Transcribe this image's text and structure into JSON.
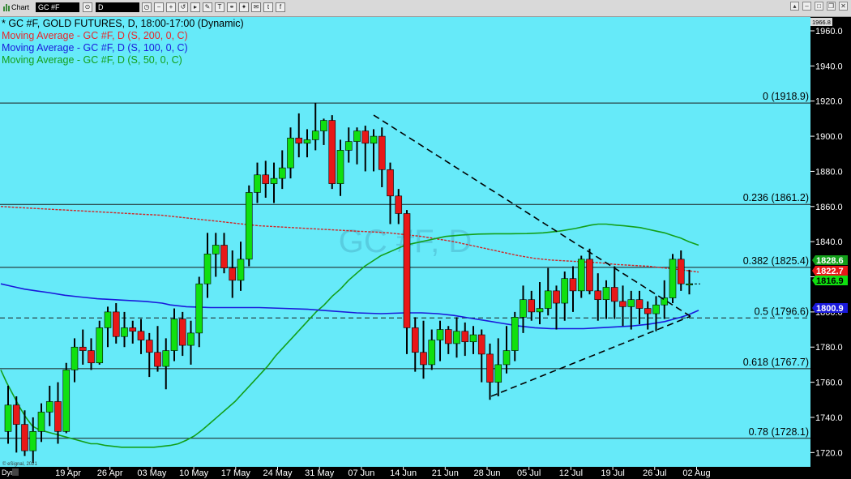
{
  "window": {
    "app_label": "Chart",
    "symbol": "GC #F",
    "interval": "D"
  },
  "legend": [
    {
      "text": "* GC #F, GOLD FUTURES, D, 18:00-17:00 (Dynamic)",
      "color": "#000000"
    },
    {
      "text": "Moving Average - GC #F, D (S, 200, 0, C)",
      "color": "#e8262a"
    },
    {
      "text": "Moving Average - GC #F, D (S, 100, 0, C)",
      "color": "#1a1adb"
    },
    {
      "text": "Moving Average - GC #F, D (S, 50, 0, C)",
      "color": "#13a01a"
    }
  ],
  "watermark": "GC #F, D",
  "footer": {
    "copyright": "© eSignal, 2021",
    "dyn_label": "Dyn"
  },
  "colors": {
    "background": "#66eaf9",
    "up": "#10e010",
    "down": "#e81818",
    "ma200": "#d22525",
    "ma100": "#1a1adb",
    "ma50": "#13a01a"
  },
  "chart_data": {
    "type": "candlestick",
    "instrument": "GC #F, GOLD FUTURES",
    "ylim": [
      1712,
      1966.8
    ],
    "y_ticks": [
      "1720.0",
      "1740.0",
      "1760.0",
      "1780.0",
      "1800.0",
      "1820.0",
      "1840.0",
      "1860.0",
      "1880.0",
      "1900.0",
      "1920.0",
      "1940.0",
      "1960.0"
    ],
    "top_price_label": "1966.8",
    "x_tick_labels": [
      "19 Apr",
      "26 Apr",
      "03 May",
      "10 May",
      "17 May",
      "24 May",
      "31 May",
      "07 Jun",
      "14 Jun",
      "21 Jun",
      "28 Jun",
      "05 Jul",
      "12 Jul",
      "19 Jul",
      "26 Jul",
      "02 Aug"
    ],
    "fibonacci": [
      {
        "label": "0 (1918.9)",
        "value": 1918.9
      },
      {
        "label": "0.236 (1861.2)",
        "value": 1861.2
      },
      {
        "label": "0.382 (1825.4)",
        "value": 1825.4
      },
      {
        "label": "0.5 (1796.6)",
        "value": 1796.6
      },
      {
        "label": "0.618 (1767.7)",
        "value": 1767.7
      },
      {
        "label": "0.78 (1728.1)",
        "value": 1728.1
      }
    ],
    "price_tags": [
      {
        "label": "1828.6",
        "value": 1828.6,
        "color": "#13a01a"
      },
      {
        "label": "1822.7",
        "value": 1822.7,
        "color": "#e81818"
      },
      {
        "label": "1816.9",
        "value": 1816.9,
        "color": "#10e010"
      },
      {
        "label": "1800.9",
        "value": 1800.9,
        "color": "#1a1adb"
      }
    ],
    "candles": [
      [
        1732,
        1758,
        1725,
        1747
      ],
      [
        1747,
        1752,
        1720,
        1736
      ],
      [
        1736,
        1744,
        1718,
        1721
      ],
      [
        1721,
        1740,
        1714,
        1732
      ],
      [
        1732,
        1748,
        1726,
        1743
      ],
      [
        1743,
        1758,
        1735,
        1749
      ],
      [
        1749,
        1760,
        1725,
        1732
      ],
      [
        1732,
        1771,
        1731,
        1767
      ],
      [
        1767,
        1785,
        1760,
        1780
      ],
      [
        1780,
        1790,
        1770,
        1778
      ],
      [
        1778,
        1785,
        1767,
        1771
      ],
      [
        1771,
        1795,
        1770,
        1791
      ],
      [
        1791,
        1803,
        1780,
        1800
      ],
      [
        1800,
        1805,
        1782,
        1786
      ],
      [
        1786,
        1800,
        1780,
        1791
      ],
      [
        1791,
        1795,
        1782,
        1789
      ],
      [
        1789,
        1796,
        1776,
        1784
      ],
      [
        1784,
        1788,
        1763,
        1777
      ],
      [
        1777,
        1792,
        1766,
        1769
      ],
      [
        1769,
        1785,
        1756,
        1778
      ],
      [
        1778,
        1802,
        1772,
        1796
      ],
      [
        1796,
        1800,
        1775,
        1781
      ],
      [
        1781,
        1795,
        1770,
        1788
      ],
      [
        1788,
        1820,
        1780,
        1816
      ],
      [
        1816,
        1845,
        1808,
        1833
      ],
      [
        1833,
        1845,
        1820,
        1838
      ],
      [
        1838,
        1845,
        1822,
        1825
      ],
      [
        1825,
        1835,
        1808,
        1818
      ],
      [
        1818,
        1840,
        1812,
        1830
      ],
      [
        1830,
        1872,
        1826,
        1868
      ],
      [
        1868,
        1885,
        1862,
        1878
      ],
      [
        1878,
        1886,
        1865,
        1873
      ],
      [
        1873,
        1885,
        1862,
        1876
      ],
      [
        1876,
        1892,
        1870,
        1882
      ],
      [
        1882,
        1905,
        1876,
        1899
      ],
      [
        1899,
        1913,
        1888,
        1896
      ],
      [
        1896,
        1904,
        1888,
        1898
      ],
      [
        1898,
        1919,
        1892,
        1903
      ],
      [
        1903,
        1910,
        1895,
        1909
      ],
      [
        1909,
        1912,
        1870,
        1873
      ],
      [
        1873,
        1898,
        1866,
        1892
      ],
      [
        1892,
        1905,
        1885,
        1897
      ],
      [
        1897,
        1905,
        1884,
        1903
      ],
      [
        1903,
        1906,
        1880,
        1896
      ],
      [
        1896,
        1904,
        1880,
        1900
      ],
      [
        1900,
        1905,
        1871,
        1881
      ],
      [
        1881,
        1885,
        1850,
        1866
      ],
      [
        1866,
        1870,
        1850,
        1856
      ],
      [
        1856,
        1858,
        1776,
        1791
      ],
      [
        1791,
        1797,
        1766,
        1777
      ],
      [
        1777,
        1795,
        1762,
        1770
      ],
      [
        1770,
        1790,
        1767,
        1784
      ],
      [
        1784,
        1795,
        1772,
        1790
      ],
      [
        1790,
        1792,
        1776,
        1782
      ],
      [
        1782,
        1797,
        1774,
        1789
      ],
      [
        1789,
        1794,
        1775,
        1783
      ],
      [
        1783,
        1792,
        1776,
        1787
      ],
      [
        1787,
        1790,
        1760,
        1776
      ],
      [
        1776,
        1782,
        1750,
        1760
      ],
      [
        1760,
        1785,
        1752,
        1770
      ],
      [
        1770,
        1792,
        1765,
        1778
      ],
      [
        1778,
        1800,
        1772,
        1797
      ],
      [
        1797,
        1815,
        1788,
        1807
      ],
      [
        1807,
        1812,
        1795,
        1800
      ],
      [
        1800,
        1817,
        1793,
        1802
      ],
      [
        1802,
        1825,
        1798,
        1812
      ],
      [
        1812,
        1815,
        1790,
        1805
      ],
      [
        1805,
        1823,
        1795,
        1819
      ],
      [
        1819,
        1826,
        1800,
        1812
      ],
      [
        1812,
        1832,
        1808,
        1830
      ],
      [
        1830,
        1836,
        1810,
        1812
      ],
      [
        1812,
        1822,
        1795,
        1807
      ],
      [
        1807,
        1818,
        1796,
        1814
      ],
      [
        1814,
        1826,
        1796,
        1806
      ],
      [
        1806,
        1815,
        1792,
        1803
      ],
      [
        1803,
        1812,
        1790,
        1807
      ],
      [
        1807,
        1812,
        1793,
        1802
      ],
      [
        1802,
        1806,
        1790,
        1799
      ],
      [
        1799,
        1809,
        1789,
        1804
      ],
      [
        1804,
        1818,
        1796,
        1808
      ],
      [
        1808,
        1833,
        1805,
        1830
      ],
      [
        1830,
        1835,
        1812,
        1816
      ],
      [
        1816,
        1824,
        1810,
        1816
      ]
    ],
    "ma50": [
      [
        1,
        1767
      ],
      [
        8,
        1760
      ],
      [
        16,
        1753
      ],
      [
        24,
        1746
      ],
      [
        32,
        1740
      ],
      [
        40,
        1735
      ],
      [
        48,
        1733
      ],
      [
        56,
        1732
      ],
      [
        64,
        1731
      ],
      [
        72,
        1730
      ],
      [
        80,
        1729
      ],
      [
        88,
        1728
      ],
      [
        96,
        1727
      ],
      [
        104,
        1726
      ],
      [
        112,
        1725
      ],
      [
        120,
        1725
      ],
      [
        130,
        1724
      ],
      [
        140,
        1723.5
      ],
      [
        150,
        1723
      ],
      [
        160,
        1723
      ],
      [
        170,
        1723
      ],
      [
        180,
        1723
      ],
      [
        190,
        1723
      ],
      [
        200,
        1723.5
      ],
      [
        210,
        1724
      ],
      [
        220,
        1725
      ],
      [
        230,
        1727
      ],
      [
        240,
        1729.5
      ],
      [
        250,
        1733
      ],
      [
        260,
        1737
      ],
      [
        270,
        1741
      ],
      [
        280,
        1745
      ],
      [
        290,
        1749
      ],
      [
        300,
        1754
      ],
      [
        310,
        1759
      ],
      [
        320,
        1764
      ],
      [
        330,
        1769
      ],
      [
        340,
        1775
      ],
      [
        350,
        1780
      ],
      [
        360,
        1785
      ],
      [
        370,
        1790
      ],
      [
        380,
        1795
      ],
      [
        390,
        1800
      ],
      [
        400,
        1804
      ],
      [
        410,
        1809
      ],
      [
        420,
        1813
      ],
      [
        430,
        1818
      ],
      [
        440,
        1822
      ],
      [
        450,
        1826
      ],
      [
        460,
        1829
      ],
      [
        470,
        1832
      ],
      [
        480,
        1834
      ],
      [
        490,
        1836
      ],
      [
        500,
        1838
      ],
      [
        510,
        1839
      ],
      [
        520,
        1840
      ],
      [
        530,
        1841
      ],
      [
        540,
        1842
      ],
      [
        550,
        1843
      ],
      [
        570,
        1843.8
      ],
      [
        590,
        1844.3
      ],
      [
        610,
        1844.5
      ],
      [
        630,
        1844.5
      ],
      [
        650,
        1844.6
      ],
      [
        670,
        1845
      ],
      [
        690,
        1846
      ],
      [
        710,
        1847.5
      ],
      [
        720,
        1848.5
      ],
      [
        730,
        1849.5
      ],
      [
        738,
        1850
      ],
      [
        748,
        1850
      ],
      [
        758,
        1849.5
      ],
      [
        770,
        1849
      ],
      [
        780,
        1848.5
      ],
      [
        790,
        1848
      ],
      [
        800,
        1847
      ],
      [
        810,
        1846
      ],
      [
        820,
        1845
      ],
      [
        830,
        1843.5
      ],
      [
        840,
        1842
      ],
      [
        850,
        1840
      ],
      [
        862,
        1838
      ]
    ],
    "ma100": [
      [
        1,
        1816
      ],
      [
        15,
        1814.5
      ],
      [
        30,
        1813
      ],
      [
        45,
        1812
      ],
      [
        60,
        1811
      ],
      [
        80,
        1809.5
      ],
      [
        100,
        1808.5
      ],
      [
        120,
        1807.5
      ],
      [
        140,
        1807
      ],
      [
        160,
        1806.5
      ],
      [
        180,
        1806
      ],
      [
        200,
        1805
      ],
      [
        210,
        1804
      ],
      [
        220,
        1803.5
      ],
      [
        230,
        1803
      ],
      [
        260,
        1802.5
      ],
      [
        290,
        1802.5
      ],
      [
        320,
        1802.5
      ],
      [
        350,
        1802
      ],
      [
        380,
        1801.5
      ],
      [
        410,
        1800.5
      ],
      [
        440,
        1799.5
      ],
      [
        470,
        1799
      ],
      [
        500,
        1799.5
      ],
      [
        520,
        1799.5
      ],
      [
        540,
        1799
      ],
      [
        560,
        1798
      ],
      [
        580,
        1796.5
      ],
      [
        600,
        1795
      ],
      [
        620,
        1793.5
      ],
      [
        640,
        1792
      ],
      [
        660,
        1791
      ],
      [
        680,
        1790.5
      ],
      [
        700,
        1790.5
      ],
      [
        720,
        1790.5
      ],
      [
        740,
        1791
      ],
      [
        760,
        1791.5
      ],
      [
        780,
        1792
      ],
      [
        800,
        1793
      ],
      [
        820,
        1794.5
      ],
      [
        840,
        1797
      ],
      [
        850,
        1798.5
      ],
      [
        862,
        1800.9
      ]
    ],
    "ma200": [
      [
        1,
        1860
      ],
      [
        20,
        1859.5
      ],
      [
        40,
        1859
      ],
      [
        60,
        1858.5
      ],
      [
        80,
        1858
      ],
      [
        100,
        1857.5
      ],
      [
        120,
        1857
      ],
      [
        140,
        1856.5
      ],
      [
        160,
        1856
      ],
      [
        180,
        1855.5
      ],
      [
        200,
        1855
      ],
      [
        220,
        1854
      ],
      [
        240,
        1853
      ],
      [
        260,
        1852
      ],
      [
        280,
        1851
      ],
      [
        300,
        1850
      ],
      [
        320,
        1849
      ],
      [
        340,
        1848.5
      ],
      [
        360,
        1848
      ],
      [
        380,
        1847.5
      ],
      [
        400,
        1847
      ],
      [
        420,
        1846.5
      ],
      [
        440,
        1846
      ],
      [
        460,
        1845.5
      ],
      [
        480,
        1845
      ],
      [
        500,
        1844
      ],
      [
        520,
        1843
      ],
      [
        540,
        1841.5
      ],
      [
        560,
        1840
      ],
      [
        580,
        1838
      ],
      [
        600,
        1836
      ],
      [
        620,
        1834
      ],
      [
        640,
        1832
      ],
      [
        660,
        1830.5
      ],
      [
        680,
        1829.5
      ],
      [
        700,
        1829
      ],
      [
        720,
        1828.5
      ],
      [
        740,
        1828
      ],
      [
        760,
        1827
      ],
      [
        780,
        1826.5
      ],
      [
        800,
        1826
      ],
      [
        820,
        1825
      ],
      [
        840,
        1824
      ],
      [
        862,
        1822.7
      ]
    ],
    "trendlines": [
      {
        "from": [
          0,
          1912
        ],
        "to": [
          0,
          1797.5
        ],
        "from_x": 461,
        "to_x": 852
      },
      {
        "from": [
          0,
          1752
        ],
        "to": [
          0,
          1797.5
        ],
        "from_x": 606,
        "to_x": 852
      }
    ]
  }
}
